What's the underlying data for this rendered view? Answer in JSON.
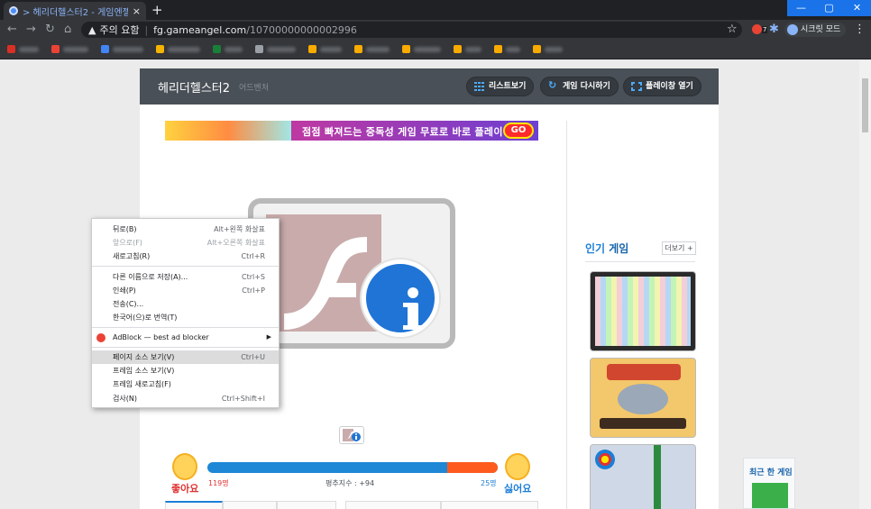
{
  "browser": {
    "tab_title": "> 헤리더헬스터2 - 게임엔젤 게",
    "close_glyph": "×",
    "new_tab_glyph": "+",
    "security_warning": "주의 요함",
    "url_host": "fg.gameangel.com",
    "url_path": "/10700000000002996",
    "incognito_label": "시크릿 모드",
    "extension_badge": "7"
  },
  "header": {
    "title": "헤리더헬스터2",
    "genre": "어드벤처",
    "list_button": "리스트보기",
    "restart_button": "게임 다시하기",
    "fullscreen_button": "플레이창 열기"
  },
  "banner": {
    "text": "점점 빠져드는 중독성 게임 무료로 바로 플레이!",
    "go": "GO"
  },
  "vote": {
    "like_label": "좋아요",
    "like_count": "119명",
    "dislike_label": "싫어요",
    "dislike_count": "25명",
    "net_label": "평추지수 : +94",
    "like_ratio": 0.826
  },
  "sidebar": {
    "popular_title_a": "인기",
    "popular_title_b": " 게임",
    "more_button": "더보기 +",
    "recent_title": "최근 한 게임"
  },
  "context_menu": {
    "items": [
      {
        "label": "뒤로(B)",
        "shortcut": "Alt+왼쪽 화살표",
        "disabled": false
      },
      {
        "label": "앞으로(F)",
        "shortcut": "Alt+오른쪽 화살표",
        "disabled": true
      },
      {
        "label": "새로고침(R)",
        "shortcut": "Ctrl+R",
        "disabled": false
      },
      {
        "label": "다른 이름으로 저장(A)...",
        "shortcut": "Ctrl+S",
        "disabled": false
      },
      {
        "label": "인쇄(P)",
        "shortcut": "Ctrl+P",
        "disabled": false
      },
      {
        "label": "전송(C)...",
        "shortcut": "",
        "disabled": false
      },
      {
        "label": "한국어(으)로 번역(T)",
        "shortcut": "",
        "disabled": false
      },
      {
        "label": "AdBlock — best ad blocker",
        "shortcut": "",
        "disabled": false
      },
      {
        "label": "페이지 소스 보기(V)",
        "shortcut": "Ctrl+U",
        "disabled": false
      },
      {
        "label": "프레임 소스 보기(V)",
        "shortcut": "",
        "disabled": false
      },
      {
        "label": "프레임 새로고침(F)",
        "shortcut": "",
        "disabled": false
      },
      {
        "label": "검사(N)",
        "shortcut": "Ctrl+Shift+I",
        "disabled": false
      }
    ]
  },
  "colors": {
    "accent": "#1a73e8",
    "like": "#1e87d6",
    "dislike": "#ff5a1e"
  }
}
